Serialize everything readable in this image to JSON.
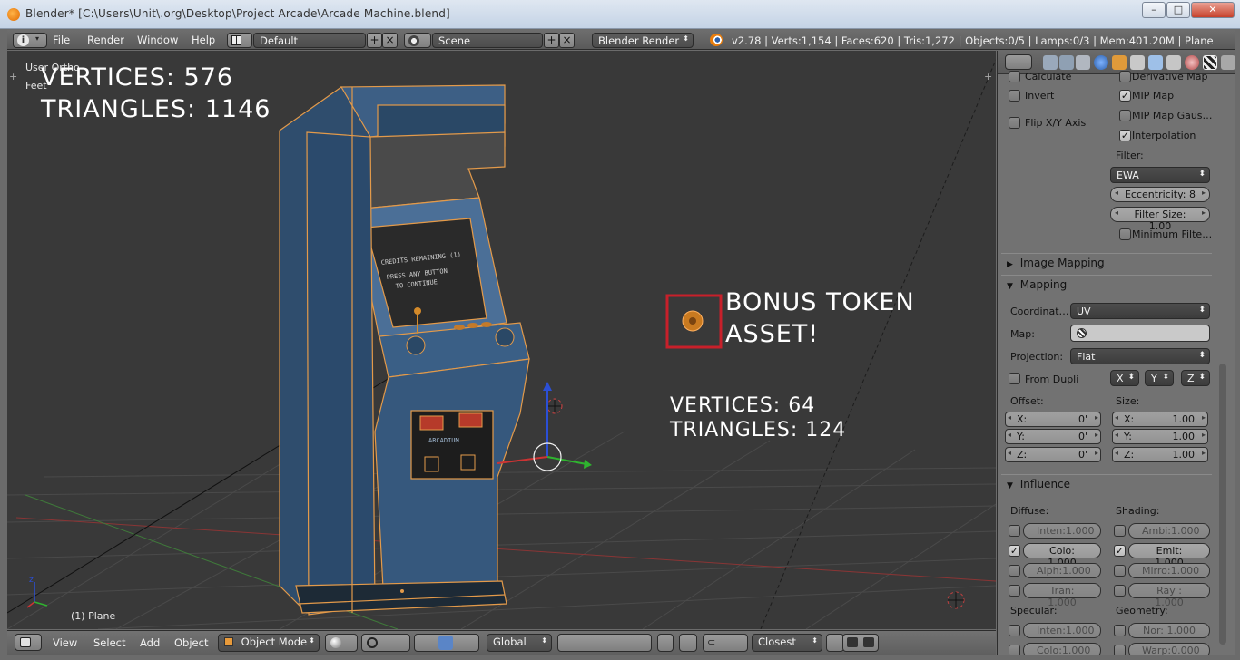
{
  "window": {
    "title": "Blender* [C:\\Users\\Unit\\.org\\Desktop\\Project Arcade\\Arcade Machine.blend]",
    "min": "–",
    "max": "□",
    "close": "✕"
  },
  "header": {
    "menus": [
      "File",
      "Render",
      "Window",
      "Help"
    ],
    "layout": "Default",
    "scene": "Scene",
    "engine": "Blender Render",
    "stats": "v2.78 | Verts:1,154 | Faces:620 | Tris:1,272 | Objects:0/5 | Lamps:0/3 | Mem:401.20M | Plane"
  },
  "viewport": {
    "view_name": "User Ortho",
    "units": "Feet",
    "object_label": "(1) Plane",
    "cabinet_stats": {
      "vertices": "VERTICES: 576",
      "triangles": "TRIANGLES: 1146"
    },
    "token_title": [
      "BONUS TOKEN",
      "ASSET!"
    ],
    "token_stats": {
      "vertices": "VERTICES: 64",
      "triangles": "TRIANGLES: 124"
    },
    "screen_text": [
      "CREDITS REMAINING (1)",
      "PRESS ANY BUTTON",
      "TO CONTINUE"
    ],
    "marquee_brand": "ARCADIUM",
    "colors": {
      "background": "#393939",
      "wire": "#e39a4a",
      "cabinet": "#3a5f86",
      "token": "#c97a20"
    }
  },
  "footer": {
    "menus": [
      "View",
      "Select",
      "Add",
      "Object"
    ],
    "mode": "Object Mode",
    "orientation": "Global",
    "snap": "Closest"
  },
  "properties": {
    "top_checks": {
      "calculate": "Calculate",
      "derivative_map": "Derivative Map",
      "invert": "Invert",
      "mip_map": "MIP Map",
      "flip_xy": "Flip X/Y Axis",
      "mip_map_gauss": "MIP Map Gaus…",
      "interpolation": "Interpolation"
    },
    "filter_label": "Filter:",
    "filter_value": "EWA",
    "eccentricity": {
      "label": "Eccentricity:",
      "value": "8"
    },
    "filter_size": {
      "label": "Filter Size:",
      "value": "1.00"
    },
    "minimum_filter": "Minimum Filte…",
    "image_mapping": "Image Mapping",
    "mapping": {
      "title": "Mapping",
      "coordinates_label": "Coordinat…",
      "coordinates_value": "UV",
      "map_label": "Map:",
      "projection_label": "Projection:",
      "projection_value": "Flat",
      "from_dupli": "From Dupli",
      "axes": [
        "X",
        "Y",
        "Z"
      ],
      "offset_label": "Offset:",
      "size_label": "Size:",
      "offset": [
        {
          "axis": "X:",
          "value": "0'"
        },
        {
          "axis": "Y:",
          "value": "0'"
        },
        {
          "axis": "Z:",
          "value": "0'"
        }
      ],
      "size": [
        {
          "axis": "X:",
          "value": "1.00"
        },
        {
          "axis": "Y:",
          "value": "1.00"
        },
        {
          "axis": "Z:",
          "value": "1.00"
        }
      ]
    },
    "influence": {
      "title": "Influence",
      "diffuse_label": "Diffuse:",
      "shading_label": "Shading:",
      "specular_label": "Specular:",
      "geometry_label": "Geometry:",
      "diffuse": [
        {
          "label": "Inten:",
          "value": "1.000",
          "on": false
        },
        {
          "label": "Colo:",
          "value": "1.000",
          "on": true
        },
        {
          "label": "Alph:",
          "value": "1.000",
          "on": false
        },
        {
          "label": "Tran:",
          "value": "1.000",
          "on": false
        }
      ],
      "shading": [
        {
          "label": "Ambi:",
          "value": "1.000",
          "on": false
        },
        {
          "label": "Emit:",
          "value": "1.000",
          "on": true
        },
        {
          "label": "Mirro:",
          "value": "1.000",
          "on": false
        },
        {
          "label": "Ray :",
          "value": "1.000",
          "on": false
        }
      ],
      "specular": [
        {
          "label": "Inten:",
          "value": "1.000"
        },
        {
          "label": "Colo:",
          "value": "1.000"
        }
      ],
      "geometry": [
        {
          "label": "Nor:",
          "value": "1.000"
        },
        {
          "label": "Warp:",
          "value": "0.000"
        }
      ]
    }
  }
}
